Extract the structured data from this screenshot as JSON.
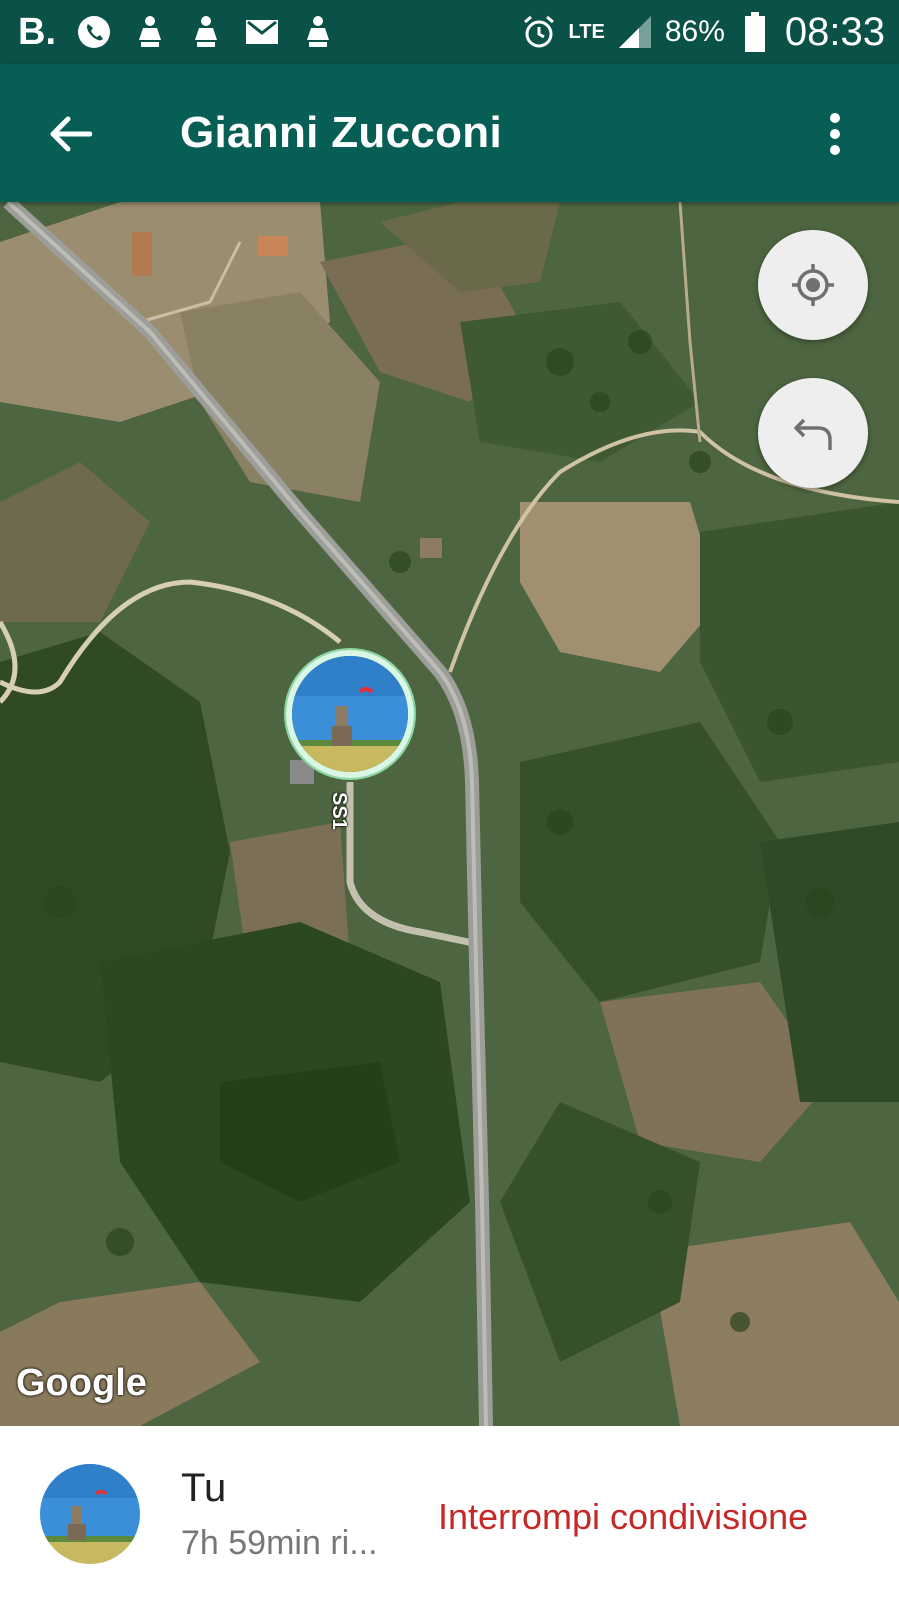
{
  "status_bar": {
    "carrier_letter": "B.",
    "network": "LTE",
    "battery": "86%",
    "time": "08:33",
    "icons": [
      "whatsapp-icon",
      "notification-icon",
      "notification-icon",
      "gmail-icon",
      "notification-icon",
      "alarm-icon",
      "signal-icon",
      "battery-icon"
    ]
  },
  "app_bar": {
    "title": "Gianni Zucconi",
    "back_icon": "arrow-left-icon",
    "menu_icon": "more-vert-icon"
  },
  "map": {
    "type": "satellite",
    "road_label": "SS1",
    "attribution": "Google",
    "buttons": {
      "locate_icon": "my-location-icon",
      "return_icon": "undo-arrow-icon"
    }
  },
  "bottom_panel": {
    "name": "Tu",
    "time_remaining": "7h 59min ri...",
    "action": "Interrompi condivisione"
  },
  "colors": {
    "status_bar": "#0a5247",
    "app_bar": "#075e54",
    "action_red": "#c62828",
    "marker_ring": "#d9f7e4"
  }
}
